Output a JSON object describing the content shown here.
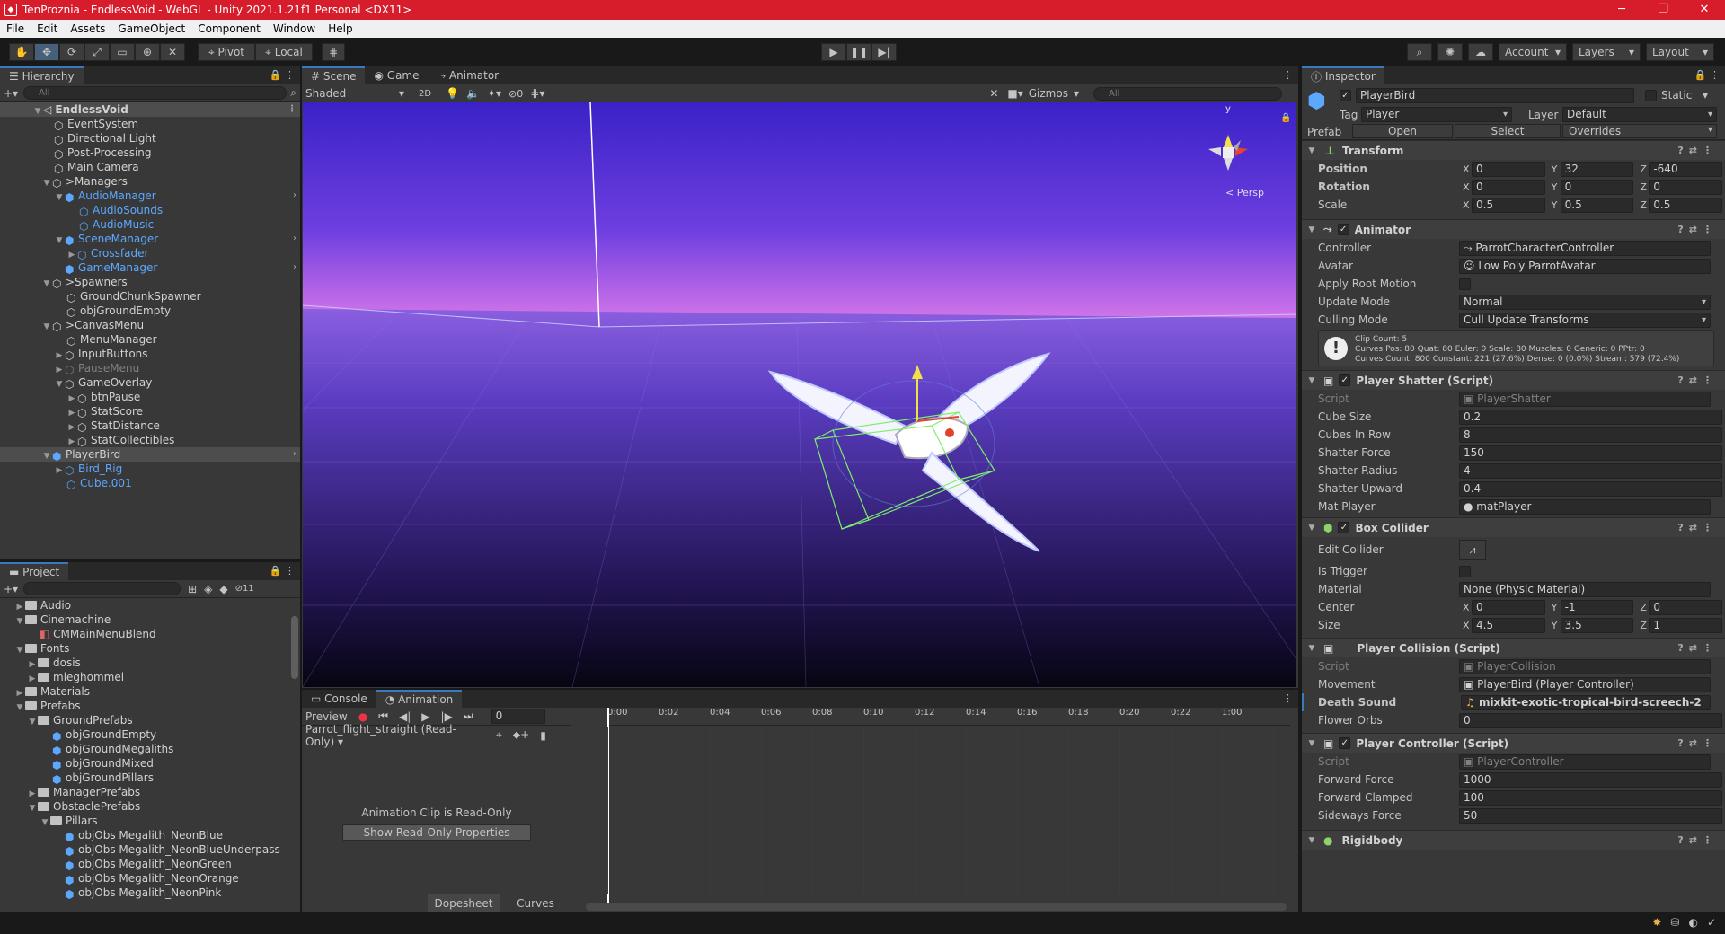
{
  "window": {
    "title": "TenProznia - EndlessVoid - WebGL - Unity 2021.1.21f1 Personal <DX11>",
    "minimize": "─",
    "maximize": "❐",
    "close": "✕"
  },
  "menubar": [
    "File",
    "Edit",
    "Assets",
    "GameObject",
    "Component",
    "Window",
    "Help"
  ],
  "toolbar": {
    "pivot": "Pivot",
    "local": "Local",
    "account": "Account",
    "layers": "Layers",
    "layout": "Layout"
  },
  "hierarchy": {
    "tab": "Hierarchy",
    "search_placeholder": "All",
    "scene": "EndlessVoid",
    "items": [
      {
        "label": "EventSystem"
      },
      {
        "label": "Directional Light"
      },
      {
        "label": "Post-Processing"
      },
      {
        "label": "Main Camera"
      },
      {
        "label": ">Managers"
      },
      {
        "label": "AudioManager"
      },
      {
        "label": "AudioSounds"
      },
      {
        "label": "AudioMusic"
      },
      {
        "label": "SceneManager"
      },
      {
        "label": "Crossfader"
      },
      {
        "label": "GameManager"
      },
      {
        "label": ">Spawners"
      },
      {
        "label": "GroundChunkSpawner"
      },
      {
        "label": "objGroundEmpty"
      },
      {
        "label": ">CanvasMenu"
      },
      {
        "label": "MenuManager"
      },
      {
        "label": "InputButtons"
      },
      {
        "label": "PauseMenu"
      },
      {
        "label": "GameOverlay"
      },
      {
        "label": "btnPause"
      },
      {
        "label": "StatScore"
      },
      {
        "label": "StatDistance"
      },
      {
        "label": "StatCollectibles"
      },
      {
        "label": "PlayerBird"
      },
      {
        "label": "Bird_Rig"
      },
      {
        "label": "Cube.001"
      }
    ]
  },
  "project": {
    "tab": "Project",
    "count": "11",
    "items": [
      {
        "label": "Audio"
      },
      {
        "label": "Cinemachine"
      },
      {
        "label": "CMMainMenuBlend"
      },
      {
        "label": "Fonts"
      },
      {
        "label": "dosis"
      },
      {
        "label": "mieghommel"
      },
      {
        "label": "Materials"
      },
      {
        "label": "Prefabs"
      },
      {
        "label": "GroundPrefabs"
      },
      {
        "label": "objGroundEmpty"
      },
      {
        "label": "objGroundMegaliths"
      },
      {
        "label": "objGroundMixed"
      },
      {
        "label": "objGroundPillars"
      },
      {
        "label": "ManagerPrefabs"
      },
      {
        "label": "ObstaclePrefabs"
      },
      {
        "label": "Pillars"
      },
      {
        "label": "objObs Megalith_NeonBlue"
      },
      {
        "label": "objObs Megalith_NeonBlueUnderpass"
      },
      {
        "label": "objObs Megalith_NeonGreen"
      },
      {
        "label": "objObs Megalith_NeonOrange"
      },
      {
        "label": "objObs Megalith_NeonPink"
      }
    ]
  },
  "scene": {
    "tabs": [
      "Scene",
      "Game",
      "Animator"
    ],
    "shading": "Shaded",
    "mode2d": "2D",
    "hidden_count": "0",
    "gizmos": "Gizmos",
    "search_placeholder": "All",
    "persp": "< Persp",
    "gizmo_y": "y",
    "sky_top": "#2b1fb0",
    "sky_horizon": "#e07ae8",
    "ground": "#3d2a86"
  },
  "animation": {
    "tabs": [
      "Console",
      "Animation"
    ],
    "preview": "Preview",
    "frame": "0",
    "clip": "Parrot_flight_straight (Read-Only)",
    "ticks": [
      "0:00",
      "0:02",
      "0:04",
      "0:06",
      "0:08",
      "0:10",
      "0:12",
      "0:14",
      "0:16",
      "0:18",
      "0:20",
      "0:22",
      "1:00"
    ],
    "readonly_msg": "Animation Clip is Read-Only",
    "show_props": "Show Read-Only Properties",
    "dopesheet": "Dopesheet",
    "curves": "Curves"
  },
  "inspector": {
    "tab": "Inspector",
    "name": "PlayerBird",
    "static": "Static",
    "tag_label": "Tag",
    "tag": "Player",
    "layer_label": "Layer",
    "layer": "Default",
    "prefab_label": "Prefab",
    "open": "Open",
    "select": "Select",
    "overrides": "Overrides",
    "transform": {
      "title": "Transform",
      "position": {
        "label": "Position",
        "x": "0",
        "y": "32",
        "z": "-640"
      },
      "rotation": {
        "label": "Rotation",
        "x": "0",
        "y": "0",
        "z": "0"
      },
      "scale": {
        "label": "Scale",
        "x": "0.5",
        "y": "0.5",
        "z": "0.5"
      }
    },
    "animator": {
      "title": "Animator",
      "controller_label": "Controller",
      "controller": "ParrotCharacterController",
      "avatar_label": "Avatar",
      "avatar": "Low Poly ParrotAvatar",
      "apply_root_label": "Apply Root Motion",
      "update_label": "Update Mode",
      "update": "Normal",
      "culling_label": "Culling Mode",
      "culling": "Cull Update Transforms",
      "info1": "Clip Count: 5",
      "info2": "Curves Pos: 80 Quat: 80 Euler: 0 Scale: 80 Muscles: 0 Generic: 0 PPtr: 0",
      "info3": "Curves Count: 800 Constant: 221 (27.6%) Dense: 0 (0.0%) Stream: 579 (72.4%)"
    },
    "shatter": {
      "title": "Player Shatter (Script)",
      "script_label": "Script",
      "script": "PlayerShatter",
      "rows": [
        {
          "label": "Cube Size",
          "value": "0.2"
        },
        {
          "label": "Cubes In Row",
          "value": "8"
        },
        {
          "label": "Shatter Force",
          "value": "150"
        },
        {
          "label": "Shatter Radius",
          "value": "4"
        },
        {
          "label": "Shatter Upward",
          "value": "0.4"
        }
      ],
      "mat_label": "Mat Player",
      "mat": "matPlayer"
    },
    "box": {
      "title": "Box Collider",
      "edit_label": "Edit Collider",
      "trigger_label": "Is Trigger",
      "material_label": "Material",
      "material": "None (Physic Material)",
      "center": {
        "label": "Center",
        "x": "0",
        "y": "-1",
        "z": "0"
      },
      "size": {
        "label": "Size",
        "x": "4.5",
        "y": "3.5",
        "z": "1"
      }
    },
    "collision": {
      "title": "Player Collision (Script)",
      "script_label": "Script",
      "script": "PlayerCollision",
      "movement_label": "Movement",
      "movement": "PlayerBird (Player Controller)",
      "death_label": "Death Sound",
      "death": "mixkit-exotic-tropical-bird-screech-2",
      "orbs_label": "Flower Orbs",
      "orbs": "0"
    },
    "controller": {
      "title": "Player Controller (Script)",
      "script_label": "Script",
      "script": "PlayerController",
      "rows": [
        {
          "label": "Forward Force",
          "value": "1000"
        },
        {
          "label": "Forward Clamped",
          "value": "100"
        },
        {
          "label": "Sideways Force",
          "value": "50"
        }
      ]
    },
    "rigidbody": {
      "title": "Rigidbody"
    }
  }
}
